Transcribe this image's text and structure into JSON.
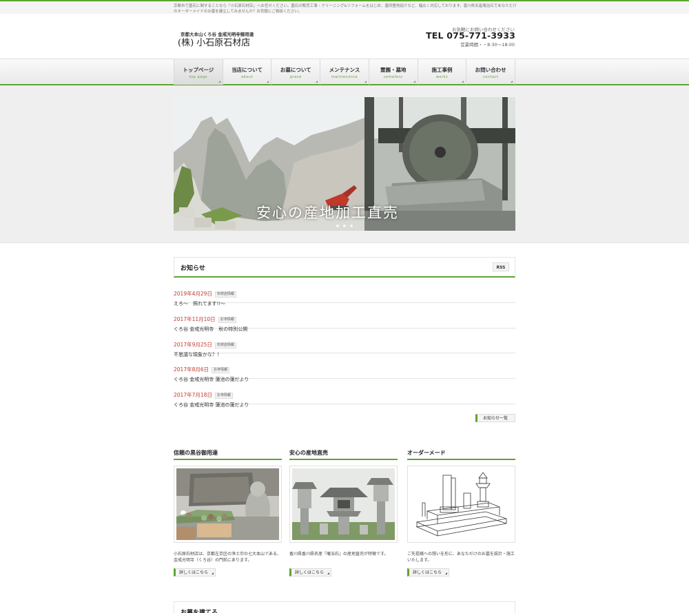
{
  "topbar": {
    "text": "京都市で墓石に関することなら「小石原石材店」へお任せください。墓石の販売工事・クリーニング&リフォームをはじめ、墓所整地紹介など、幅広く対応しております。香川県名産庵治石であなただけのオーダーメイドのお墓を建立してみませんか？お気軽にご相談ください。"
  },
  "header": {
    "logo_sub": "京都大本山くろ谷 金戒光明寺御用達",
    "logo_main": "(株) 小石原石材店",
    "contact_lead": "お気軽にお問い合わせください",
    "tel": "TEL 075-771-3933",
    "hours": "営業時間・・8:30～18:00"
  },
  "nav": [
    {
      "jp": "トップページ",
      "en": "top page"
    },
    {
      "jp": "当店について",
      "en": "about"
    },
    {
      "jp": "お墓について",
      "en": "grave"
    },
    {
      "jp": "メンテナンス",
      "en": "maintenance"
    },
    {
      "jp": "霊園・墓地",
      "en": "cemetery"
    },
    {
      "jp": "施工事例",
      "en": "works"
    },
    {
      "jp": "お問い合わせ",
      "en": "contact"
    }
  ],
  "hero": {
    "caption": "安心の産地加工直売"
  },
  "news": {
    "title": "お知らせ",
    "rss": "RSS",
    "items": [
      {
        "date": "2019年4月29日",
        "category": "石材店情報",
        "text": "えろ～　照れてます!!～"
      },
      {
        "date": "2017年11月10日",
        "category": "お寺情報",
        "text": "くろ谷 金戒光明寺　秋の特別公開"
      },
      {
        "date": "2017年9月25日",
        "category": "石材店情報",
        "text": "不思議な現象かな？！"
      },
      {
        "date": "2017年8月6日",
        "category": "お寺情報",
        "text": "くろ谷 金戒光明寺 蓮池の蓮だより"
      },
      {
        "date": "2017年7月18日",
        "category": "お寺情報",
        "text": "くろ谷 金戒光明寺 蓮池の蓮だより"
      }
    ],
    "more": "お知らせ一覧"
  },
  "columns": [
    {
      "title": "信頼の黒谷御用達",
      "text": "小石原石材店は、京都左京区の浄土宗の七大本山である、金戒光明寺（くろ谷）の門前にあります。",
      "button": "詳しくはこちら"
    },
    {
      "title": "安心の産地直売",
      "text": "香川県香川県名産『庵治石』の産地直売が特徴です。",
      "button": "詳しくはこちら"
    },
    {
      "title": "オーダーメード",
      "text": "ご先祖様への想いを形に、あなただけのお墓を設計・施工いたします。",
      "button": "詳しくはこちら"
    }
  ],
  "bottom": {
    "title": "お墓を建てる"
  },
  "colors": {
    "accent": "#5da532",
    "date": "#c0392b"
  }
}
